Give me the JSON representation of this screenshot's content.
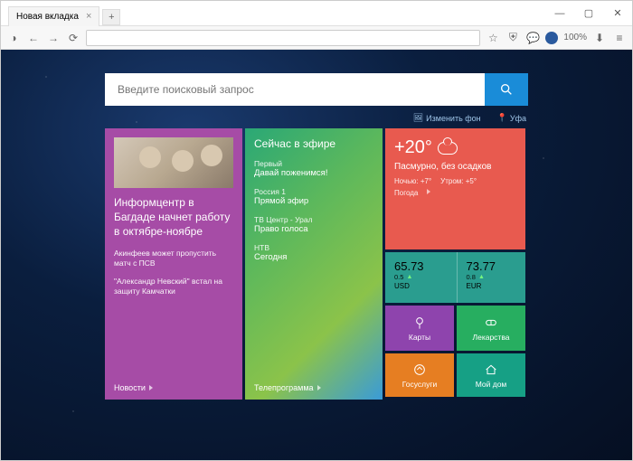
{
  "window": {
    "tab_title": "Новая вкладка",
    "zoom": "100%"
  },
  "search": {
    "placeholder": "Введите поисковый запрос"
  },
  "meta": {
    "change_bg": "Изменить фон",
    "city": "Уфа"
  },
  "news": {
    "title": "Информцентр в Багдаде начнет работу в октябре-ноябре",
    "sub1": "Акинфеев может пропустить матч с ПСВ",
    "sub2": "\"Александр Невский\" встал на защиту Камчатки",
    "footer": "Новости"
  },
  "tv": {
    "head": "Сейчас в эфире",
    "items": [
      {
        "ch": "Первый",
        "show": "Давай поженимся!"
      },
      {
        "ch": "Россия 1",
        "show": "Прямой эфир"
      },
      {
        "ch": "ТВ Центр - Урал",
        "show": "Право голоса"
      },
      {
        "ch": "НТВ",
        "show": "Сегодня"
      }
    ],
    "footer": "Телепрограмма"
  },
  "weather": {
    "temp": "+20°",
    "desc": "Пасмурно, без осадков",
    "night": "Ночью: +7°",
    "morning": "Утром: +5°",
    "footer": "Погода"
  },
  "rates": {
    "usd": {
      "val": "65.73",
      "delta": "0.5",
      "cur": "USD"
    },
    "eur": {
      "val": "73.77",
      "delta": "0.8",
      "cur": "EUR"
    }
  },
  "mini": {
    "maps": "Карты",
    "drugs": "Лекарства",
    "gos": "Госуслуги",
    "home": "Мой дом"
  }
}
